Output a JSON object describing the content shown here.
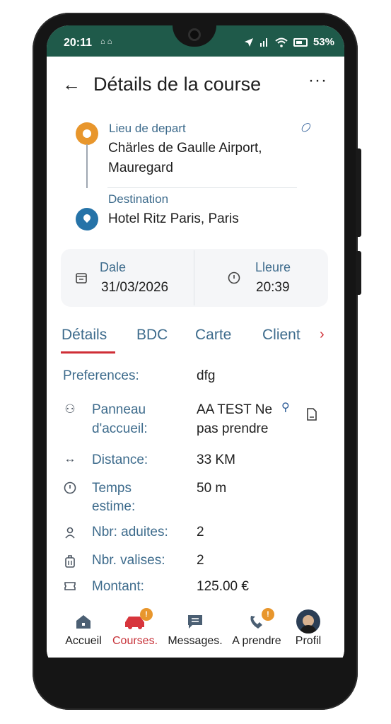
{
  "status": {
    "time": "20:11",
    "left_icons": "⌂ ⌂",
    "battery": "53%"
  },
  "header": {
    "back_icon": "arrow-left-icon",
    "title": "Détails de la course",
    "more_icon": "more-horizontal-icon"
  },
  "route": {
    "origin_label": "Lieu de depart",
    "origin_value_line1": "Chärles de Gaulle Airport,",
    "origin_value_line2": "Mauregard",
    "dest_label": "Destination",
    "dest_value": "Hotel Ritz Paris, Paris"
  },
  "schedule": {
    "date_label": "Dale",
    "date_value": "31/03/2026",
    "time_label": "Lleure",
    "time_value": "20:39"
  },
  "tabs": [
    {
      "label": "Détails"
    },
    {
      "label": "BDC"
    },
    {
      "label": "Carte"
    },
    {
      "label": "Client"
    }
  ],
  "details": {
    "preferences_label": "Preferences:",
    "preferences_value": "dfg",
    "panneau_label_1": "Panneau",
    "panneau_label_2": "d'accueil:",
    "panneau_value_1": "AA TEST Ne",
    "panneau_value_2": "pas prendre",
    "distance_label": "Distance:",
    "distance_value": "33 KM",
    "temps_label_1": "Temps",
    "temps_label_2": "estime:",
    "temps_value": "50 m",
    "adultes_label": "Nbr: aduites:",
    "adultes_value": "2",
    "valises_label": "Nbr. valises:",
    "valises_value": "2",
    "montant_label": "Montant:",
    "montant_value": "125.00 €"
  },
  "nav": [
    {
      "label": "Accueil",
      "icon": "home-icon"
    },
    {
      "label": "Courses.",
      "icon": "car-icon",
      "badge": "!",
      "active": true
    },
    {
      "label": "Messages.",
      "icon": "chat-icon"
    },
    {
      "label": "A prendre",
      "icon": "phone-icon",
      "badge": "!"
    },
    {
      "label": "Profil",
      "icon": "avatar"
    }
  ],
  "colors": {
    "accent": "#c7333a",
    "status_bar": "#1f5a4a",
    "label_blue": "#3d6b8c",
    "origin_pin": "#e8962c",
    "dest_pin": "#2673a8"
  }
}
